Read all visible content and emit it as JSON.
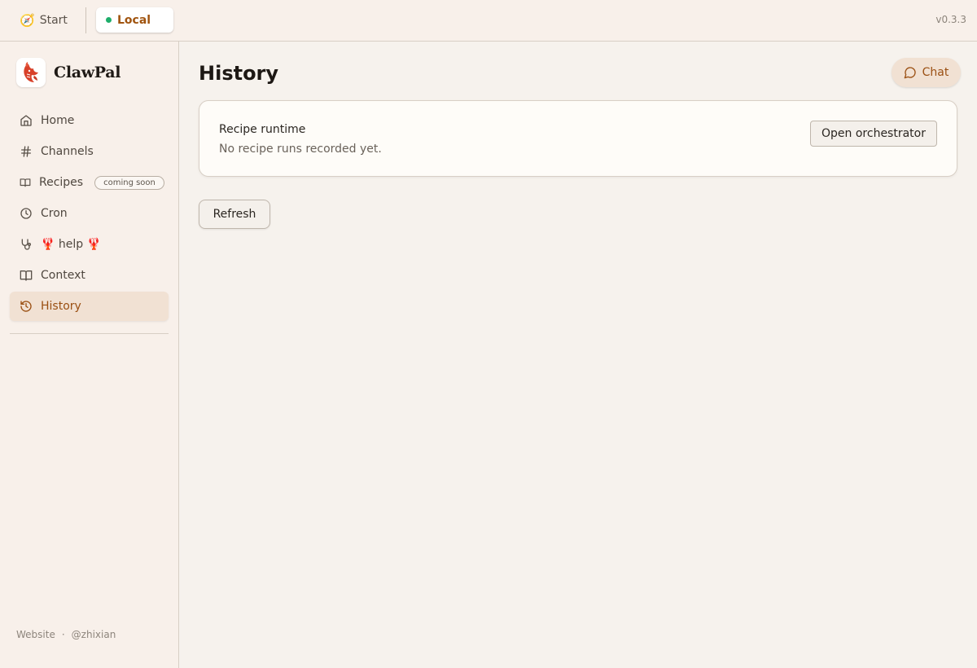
{
  "topbar": {
    "start_label": "Start",
    "start_icon": "compass-icon",
    "local_label": "Local",
    "local_status_color": "#1eae6b",
    "version": "v0.3.3"
  },
  "brand": {
    "name": "ClawPal",
    "logo_icon": "lobster-logo"
  },
  "sidebar": {
    "items": [
      {
        "label": "Home",
        "icon": "home-icon",
        "active": false
      },
      {
        "label": "Channels",
        "icon": "hash-icon",
        "active": false
      },
      {
        "label": "Recipes",
        "icon": "book-icon",
        "active": false,
        "badge": "coming soon"
      },
      {
        "label": "Cron",
        "icon": "clock-icon",
        "active": false
      },
      {
        "label": "🦞 help 🦞",
        "icon": "stethoscope-icon",
        "active": false
      },
      {
        "label": "Context",
        "icon": "open-book-icon",
        "active": false
      },
      {
        "label": "History",
        "icon": "history-icon",
        "active": true
      }
    ],
    "footer": {
      "website": "Website",
      "separator": "·",
      "author": "@zhixian"
    }
  },
  "main": {
    "title": "History",
    "chat_label": "Chat",
    "card": {
      "title": "Recipe runtime",
      "subtitle": "No recipe runs recorded yet.",
      "action_label": "Open orchestrator"
    },
    "refresh_label": "Refresh"
  },
  "colors": {
    "accent": "#9a4f12",
    "background": "#f6f2ed",
    "sidebar_bg": "#f8f0ea"
  }
}
